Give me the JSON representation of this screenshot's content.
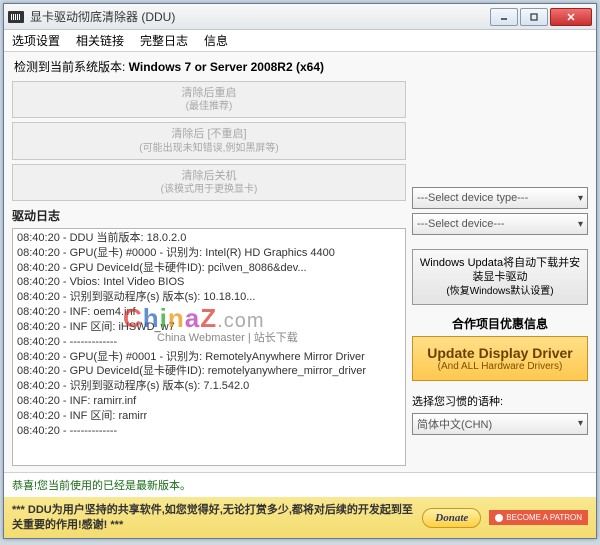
{
  "titlebar": {
    "title": "显卡驱动彻底清除器 (DDU)"
  },
  "menu": {
    "options": "选项设置",
    "links": "相关链接",
    "logs": "完整日志",
    "info": "信息"
  },
  "version": {
    "prefix": "检测到当前系统版本: ",
    "value": "Windows 7 or Server 2008R2 (x64)"
  },
  "buttons": {
    "clearRestart": {
      "t1": "清除后重启",
      "t2": "(最佳推荐)"
    },
    "clearNoRestart": {
      "t1": "清除后 [不重启]",
      "t2": "(可能出现未知错误,例如黑屏等)"
    },
    "clearShutdown": {
      "t1": "清除后关机",
      "t2": "(该模式用于更换显卡)"
    }
  },
  "logLabel": "驱动日志",
  "log": [
    "08:40:20 - DDU 当前版本: 18.0.2.0",
    "08:40:20 - GPU(显卡) #0000 - 识别为: Intel(R) HD Graphics 4400",
    "08:40:20 - GPU DeviceId(显卡硬件ID): pci\\ven_8086&dev...",
    "08:40:20 - Vbios: Intel Video BIOS",
    "08:40:20 - 识别到驱动程序(s) 版本(s): 10.18.10...",
    "08:40:20 - INF: oem4.inf",
    "08:40:20 - INF 区间: iHSWD_w7",
    "08:40:20 - -------------",
    "08:40:20 - GPU(显卡) #0001 - 识别为: RemotelyAnywhere Mirror Driver",
    "08:40:20 - GPU DeviceId(显卡硬件ID): remotelyanywhere_mirror_driver",
    "08:40:20 - 识别到驱动程序(s) 版本(s): 7.1.542.0",
    "08:40:20 - INF: ramirr.inf",
    "08:40:20 - INF 区间: ramirr",
    "08:40:20 - -------------"
  ],
  "right": {
    "deviceType": "---Select device type---",
    "device": "---Select device---",
    "wu": {
      "t1": "Windows Updata将自动下载并安装显卡驱动",
      "t2": "(恢复Windows默认设置)"
    },
    "partnerLabel": "合作项目优惠信息",
    "update": {
      "t1": "Update Display Driver",
      "t2": "(And ALL Hardware Drivers)"
    },
    "langLabel": "选择您习惯的语种:",
    "langValue": "简体中文(CHN)"
  },
  "status": "恭喜!您当前使用的已经是最新版本。",
  "footer": {
    "text": "*** DDU为用户坚持的共享软件,如您觉得好,无论打赏多少,都将对后续的开发起到至关重要的作用!感谢! ***",
    "donate": "Donate",
    "patron": "BECOME A PATRON"
  },
  "watermark": {
    "sub": "China Webmaster | 站长下载"
  }
}
